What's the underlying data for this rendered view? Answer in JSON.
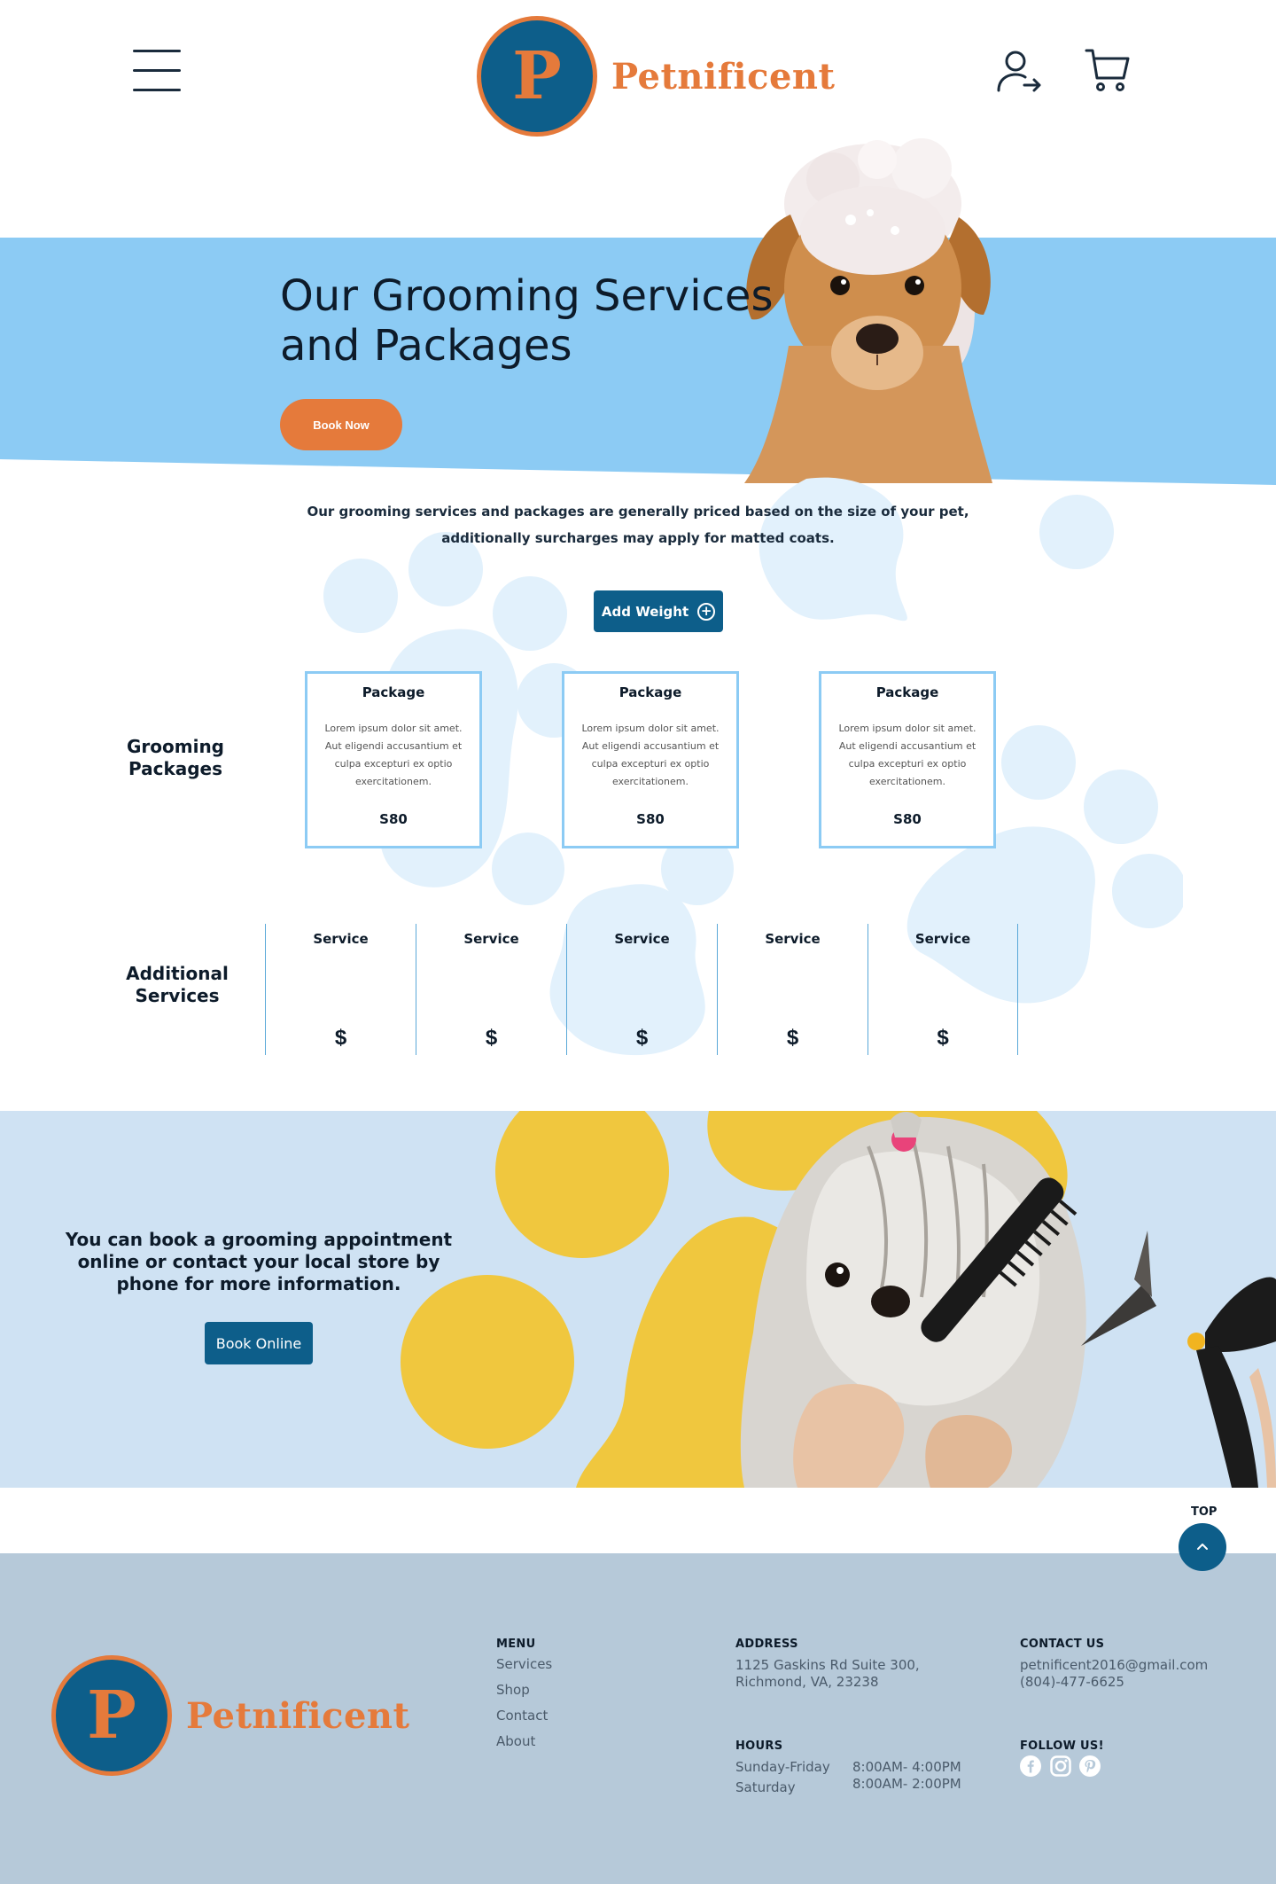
{
  "brand": {
    "name": "Petnificent",
    "initial": "P"
  },
  "hero": {
    "title_line1": "Our Grooming Services",
    "title_line2": "and Packages",
    "book_now": "Book Now"
  },
  "intro": {
    "line1": "Our grooming services and packages are generally priced based on the size of your pet,",
    "line2": "additionally surcharges may apply for matted coats."
  },
  "add_weight": "Add Weight",
  "grooming_packages": {
    "label_line1": "Grooming",
    "label_line2": "Packages",
    "packages": [
      {
        "title": "Package",
        "desc": "Lorem ipsum dolor sit amet. Aut eligendi accusantium et culpa excepturi ex optio exercitationem.",
        "price": "S80"
      },
      {
        "title": "Package",
        "desc": "Lorem ipsum dolor sit amet. Aut eligendi accusantium et culpa excepturi ex optio exercitationem.",
        "price": "S80"
      },
      {
        "title": "Package",
        "desc": "Lorem ipsum dolor sit amet. Aut eligendi accusantium et culpa excepturi ex optio exercitationem.",
        "price": "S80"
      }
    ]
  },
  "additional_services": {
    "label_line1": "Additional",
    "label_line2": "Services",
    "services": [
      {
        "title": "Service",
        "price": "$"
      },
      {
        "title": "Service",
        "price": "$"
      },
      {
        "title": "Service",
        "price": "$"
      },
      {
        "title": "Service",
        "price": "$"
      },
      {
        "title": "Service",
        "price": "$"
      }
    ]
  },
  "booking": {
    "text": "You can book a grooming appointment online or contact your local store by phone for more information.",
    "button": "Book Online"
  },
  "top": {
    "label": "TOP"
  },
  "footer": {
    "menu_head": "MENU",
    "menu": [
      "Services",
      "Shop",
      "Contact",
      "About"
    ],
    "address_head": "ADDRESS",
    "address_line1": "1125 Gaskins Rd Suite 300,",
    "address_line2": "Richmond, VA, 23238",
    "hours_head": "HOURS",
    "hours": [
      {
        "day": "Sunday-Friday",
        "time": "8:00AM- 4:00PM"
      },
      {
        "day": "Saturday",
        "time": "8:00AM- 2:00PM"
      }
    ],
    "contact_head": "CONTACT US",
    "email": "petnificent2016@gmail.com",
    "phone": "(804)-477-6625",
    "follow_head": "FOLLOW US!",
    "social_icons": [
      "facebook-icon",
      "instagram-icon",
      "pinterest-icon"
    ]
  },
  "colors": {
    "brand_orange": "#e57a3b",
    "brand_blue": "#0d5e8a",
    "hero_sky": "#8ccbf4",
    "paw_light": "#e2f1fc",
    "booking_bg": "#cfe2f3",
    "booking_yellow": "#f0c73e",
    "footer_bg": "#b6c9d9"
  }
}
